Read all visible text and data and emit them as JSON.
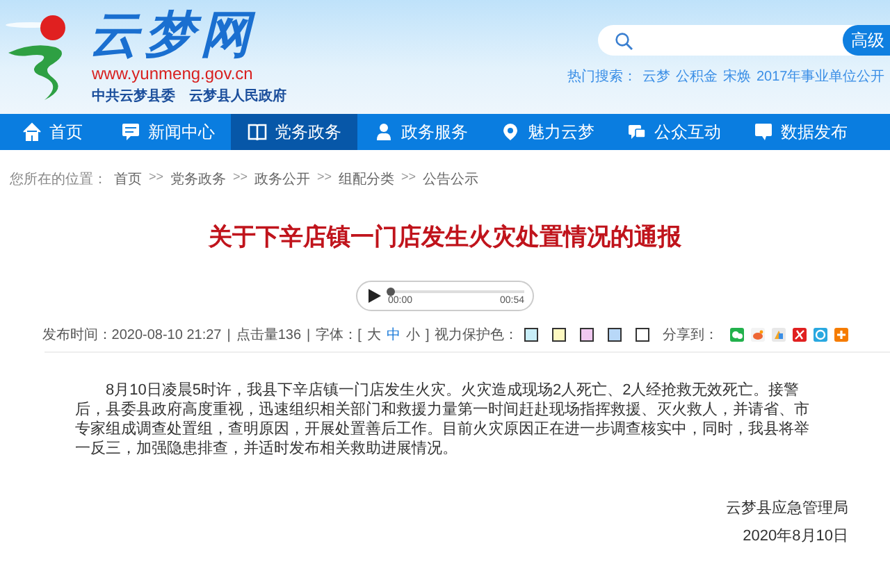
{
  "header": {
    "logo_title": "云梦网",
    "logo_url": "www.yunmeng.gov.cn",
    "logo_subtitles": [
      "中共云梦县委",
      "云梦县人民政府"
    ],
    "search_button": "高级",
    "hot_label": "热门搜索：",
    "hot_terms": [
      "云梦",
      "公积金",
      "宋焕",
      "2017年事业单位公开"
    ]
  },
  "nav": [
    {
      "label": "首页",
      "selected": false
    },
    {
      "label": "新闻中心",
      "selected": false
    },
    {
      "label": "党务政务",
      "selected": true
    },
    {
      "label": "政务服务",
      "selected": false
    },
    {
      "label": "魅力云梦",
      "selected": false
    },
    {
      "label": "公众互动",
      "selected": false
    },
    {
      "label": "数据发布",
      "selected": false
    }
  ],
  "breadcrumb": [
    {
      "kind": "label",
      "text": "您所在的位置："
    },
    {
      "kind": "link",
      "text": "首页"
    },
    {
      "kind": "separator",
      "text": ">>"
    },
    {
      "kind": "link",
      "text": "党务政务"
    },
    {
      "kind": "separator",
      "text": ">>"
    },
    {
      "kind": "link",
      "text": "政务公开"
    },
    {
      "kind": "separator",
      "text": ">>"
    },
    {
      "kind": "link",
      "text": "组配分类"
    },
    {
      "kind": "separator",
      "text": ">>"
    },
    {
      "kind": "link",
      "text": "公告公示"
    }
  ],
  "article": {
    "title": "关于下辛店镇一门店发生火灾处置情况的通报",
    "audio": {
      "current": "00:00",
      "duration": "00:54",
      "level": 0
    },
    "meta": {
      "published": "发布时间：2020-08-10 21:27",
      "sep_1": "|",
      "clicks": "点击量136",
      "sep_2": "|",
      "font_label": "字体：[",
      "font_sizes": [
        {
          "label": "大",
          "selected": false
        },
        {
          "label": "中",
          "selected": true
        },
        {
          "label": "小",
          "selected": false
        }
      ],
      "font_close": "]",
      "color_label": "视力保护色：",
      "colors": [
        {
          "color": "#c8eef8"
        },
        {
          "color": "#fdf8c0"
        },
        {
          "color": "#f0c8f0"
        },
        {
          "color": "#b8d8f8"
        },
        {
          "color": "#ffffff"
        }
      ],
      "share_label": "分享到："
    },
    "paragraphs": [
      "8月10日凌晨5时许，我县下辛店镇一门店发生火灾。火灾造成现场2人死亡、2人经抢救无效死亡。接警后，县委县政府高度重视，迅速组织相关部门和救援力量第一时间赶赴现场指挥救援、灭火救人，并请省、市专家组成调查处置组，查明原因，开展处置善后工作。目前火灾原因正在进一步调查核实中，同时，我县将举一反三，加强隐患排查，并适时发布相关救助进展情况。"
    ],
    "signature": "云梦县应急管理局",
    "date": "2020年8月10日"
  }
}
